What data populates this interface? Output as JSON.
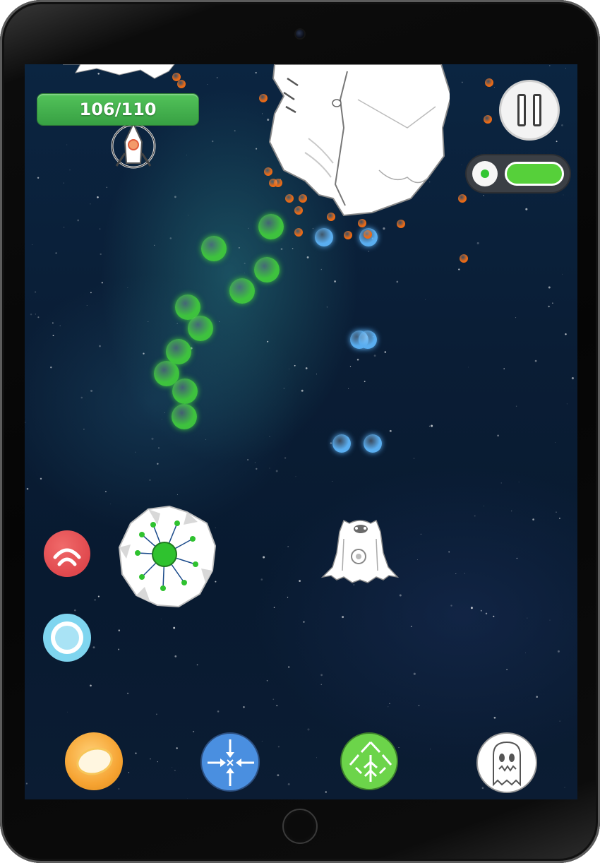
{
  "game": {
    "health": {
      "text": "106/110",
      "current": 106,
      "max": 110
    },
    "special_meter": {
      "fill": 1.0,
      "color": "#56d03a"
    },
    "colors": {
      "space_background": "#0a1d35",
      "enemy_bullet": "#3ec23e",
      "player_bullet": "#5aaef0",
      "debris": "#e86a17",
      "health_bar": "#43b04c"
    },
    "controls": {
      "pause": {
        "icon": "pause-icon"
      },
      "side_buttons": [
        {
          "name": "shockwave-button",
          "icon": "arc-waves-icon",
          "color": "#e0484d"
        },
        {
          "name": "shield-button",
          "icon": "ring-icon",
          "color": "#7fd5ef"
        }
      ],
      "weapon_buttons": [
        {
          "name": "egg-bomb-button",
          "icon": "egg-icon",
          "color": "#f6a433"
        },
        {
          "name": "implode-button",
          "icon": "inward-arrows-icon",
          "color": "#4a8fe0"
        },
        {
          "name": "leaf-spread-button",
          "icon": "leaf-arrows-icon",
          "color": "#6cd44a"
        },
        {
          "name": "ghost-button",
          "icon": "ghost-icon",
          "color": "#ffffff"
        }
      ]
    }
  }
}
